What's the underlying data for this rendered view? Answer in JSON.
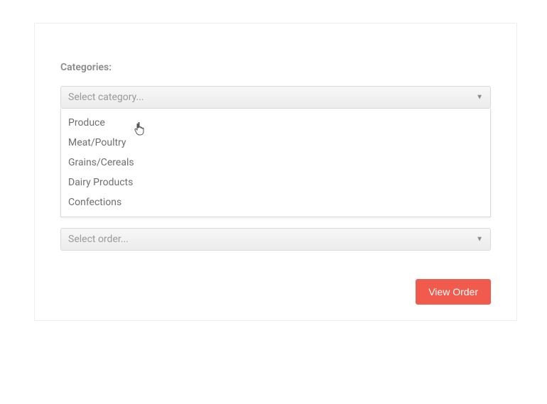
{
  "labels": {
    "categories": "Categories:"
  },
  "categoryDropdown": {
    "placeholder": "Select category...",
    "options": [
      "Produce",
      "Meat/Poultry",
      "Grains/Cereals",
      "Dairy Products",
      "Confections"
    ]
  },
  "orderDropdown": {
    "placeholder": "Select order..."
  },
  "buttons": {
    "viewOrder": "View Order"
  },
  "colors": {
    "primary": "#f15b4e"
  }
}
